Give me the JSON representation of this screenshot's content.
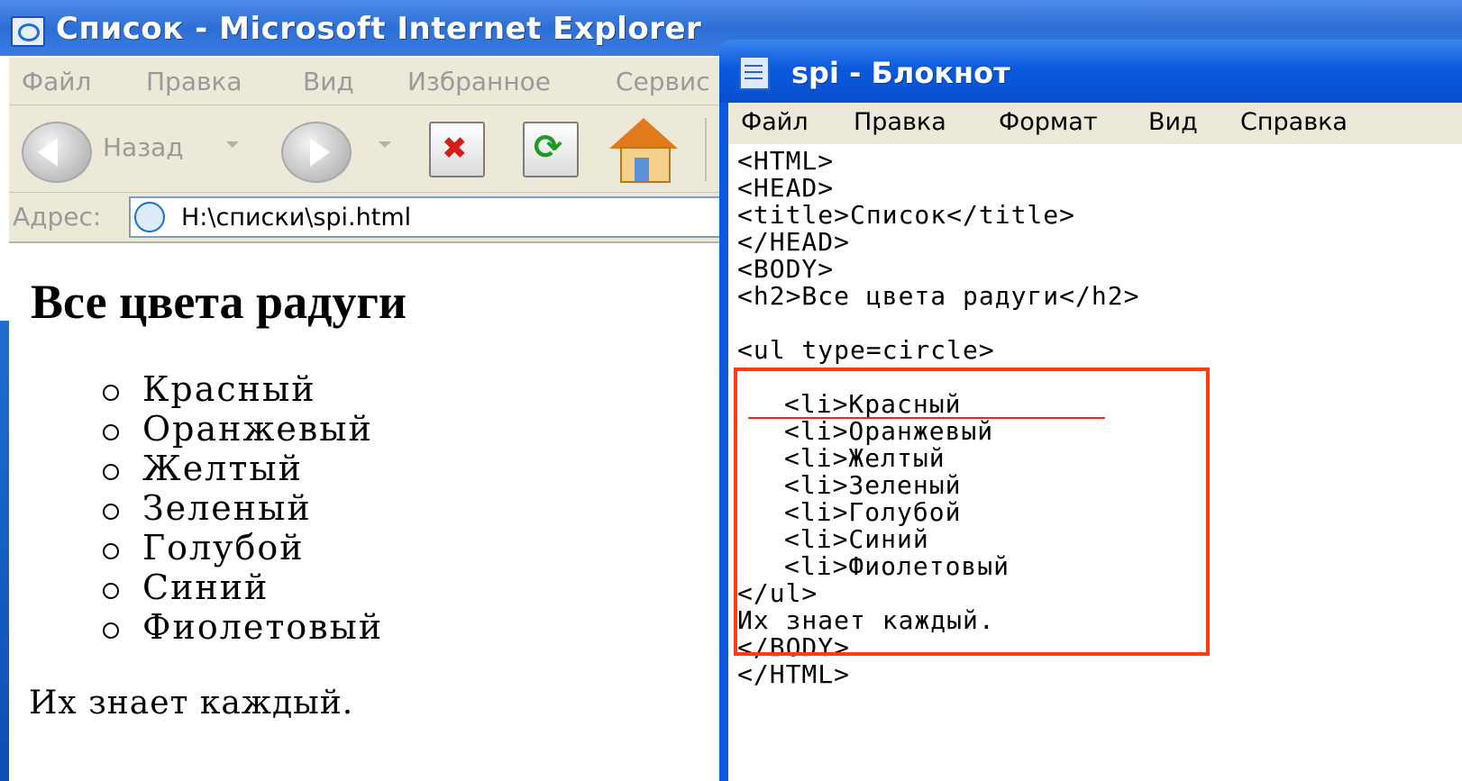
{
  "browser": {
    "title": "Список - Microsoft Internet Explorer",
    "menu": [
      "Файл",
      "Правка",
      "Вид",
      "Избранное",
      "Сервис"
    ],
    "toolbar": {
      "back_label": "Назад"
    },
    "address": {
      "label": "Адрес:",
      "value": "H:\\списки\\spi.html"
    }
  },
  "page": {
    "heading": "Все цвета радуги",
    "items": [
      "Красный",
      "Оранжевый",
      "Желтый",
      "Зеленый",
      "Голубой",
      "Синий",
      "Фиолетовый"
    ],
    "footer": "Их знает каждый."
  },
  "notepad": {
    "title": "spi - Блокнот",
    "menu": [
      "Файл",
      "Правка",
      "Формат",
      "Вид",
      "Справка"
    ],
    "code_head": [
      "<HTML>",
      "<HEAD>",
      "<title>Список</title>",
      "</HEAD>",
      "<BODY>",
      "<h2>Все цвета радуги</h2>"
    ],
    "code_ul_open": "<ul type=circle>",
    "code_items": [
      "<li>Красный",
      "<li>Оранжевый",
      "<li>Желтый",
      "<li>Зеленый",
      "<li>Голубой",
      "<li>Синий",
      "<li>Фиолетовый"
    ],
    "code_tail": [
      "</ul>",
      "Их знает каждый.",
      "</BODY>",
      "</HTML>"
    ],
    "highlight_color": "#ff3c0a"
  }
}
